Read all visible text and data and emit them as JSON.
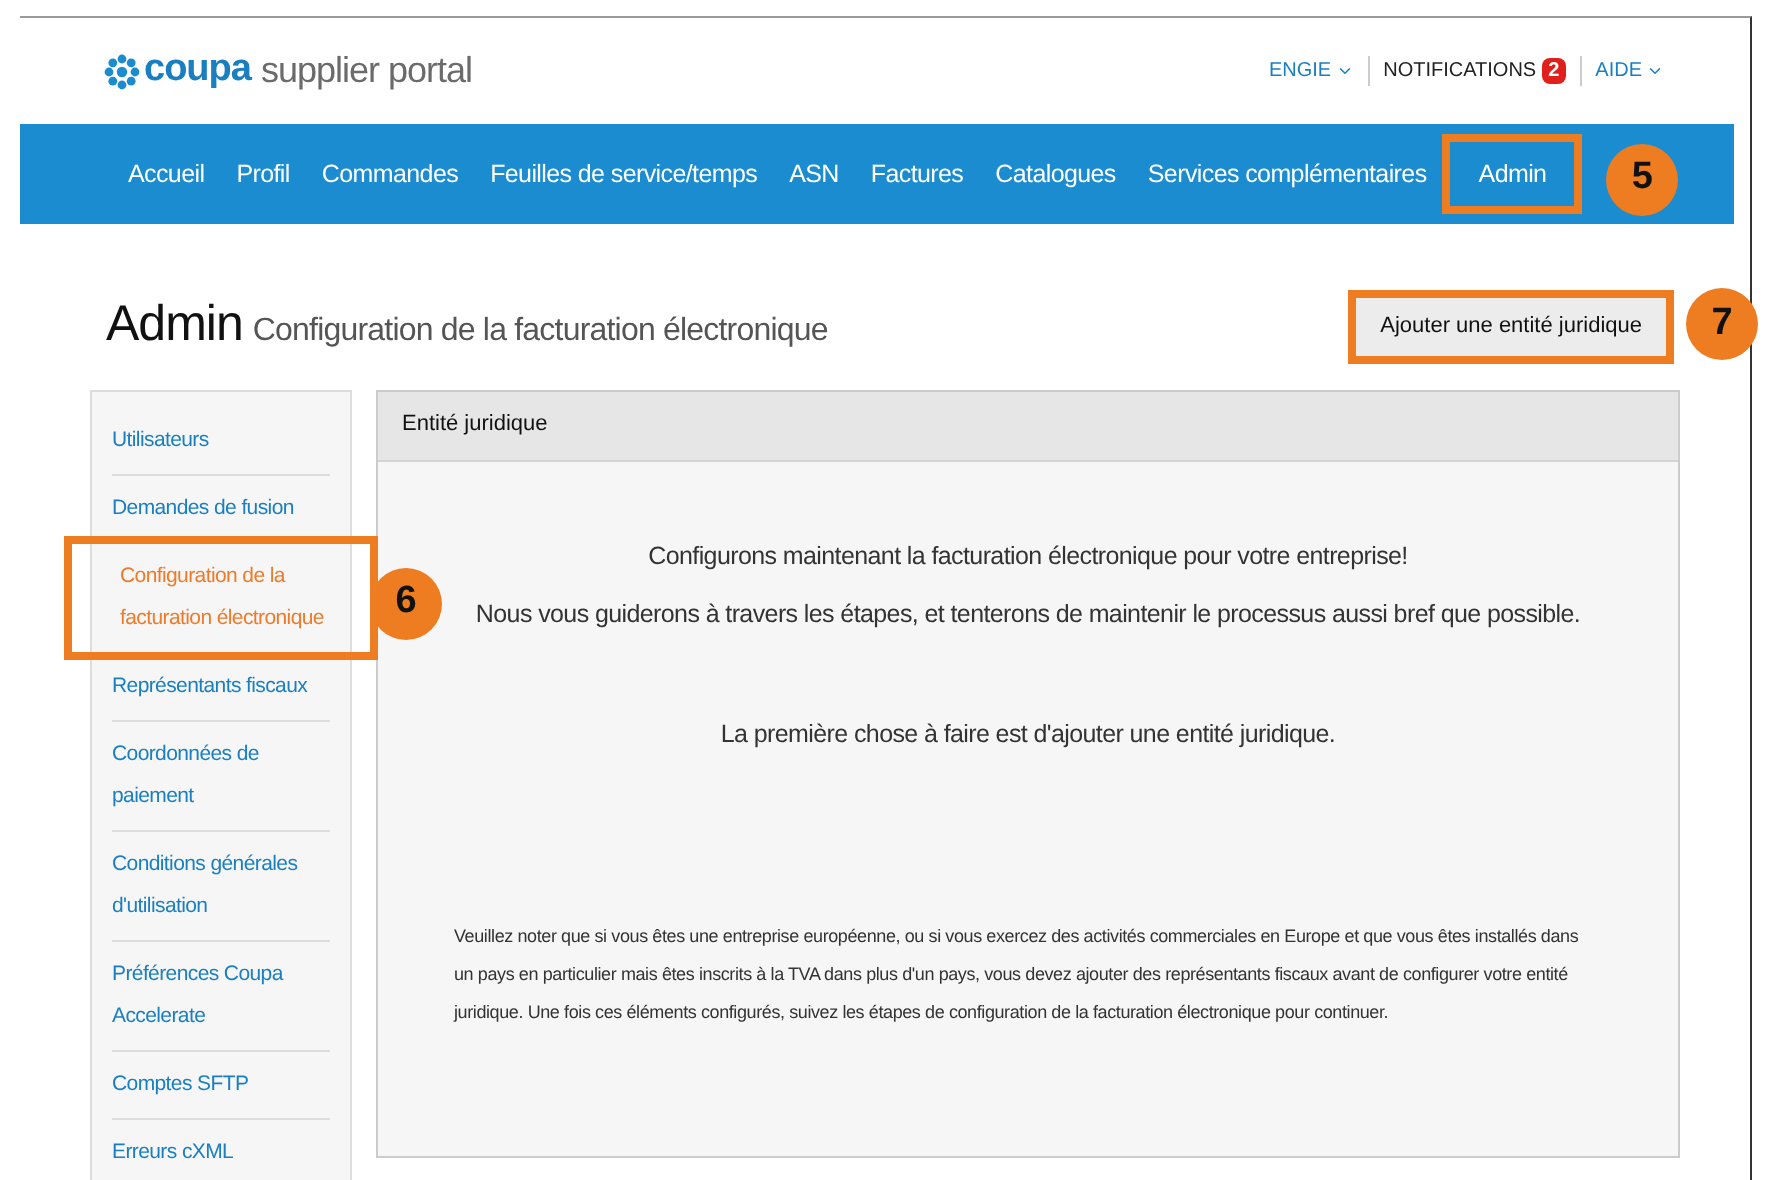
{
  "logo": {
    "brand": "coupa",
    "product": "supplier portal"
  },
  "top_links": [
    {
      "label": "ENGIE",
      "kind": "menu"
    },
    {
      "label": "NOTIFICATIONS",
      "kind": "badge",
      "badge": "2"
    },
    {
      "label": "AIDE",
      "kind": "menu"
    }
  ],
  "nav": [
    {
      "label": "Accueil",
      "highlighted": false
    },
    {
      "label": "Profil",
      "highlighted": false
    },
    {
      "label": "Commandes",
      "highlighted": false
    },
    {
      "label": "Feuilles de service/temps",
      "highlighted": false
    },
    {
      "label": "ASN",
      "highlighted": false
    },
    {
      "label": "Factures",
      "highlighted": false
    },
    {
      "label": "Catalogues",
      "highlighted": false
    },
    {
      "label": "Services complémentaires",
      "highlighted": false
    },
    {
      "label": "Admin",
      "highlighted": true,
      "callout": "5"
    }
  ],
  "page": {
    "title": "Admin",
    "subtitle": "Configuration de la facturation électronique"
  },
  "action_button": {
    "label": "Ajouter une entité juridique",
    "highlighted": true,
    "callout": "7"
  },
  "sidebar": {
    "items": [
      {
        "label": "Utilisateurs",
        "selected": false,
        "highlighted": false
      },
      {
        "label": "Demandes de fusion",
        "selected": false,
        "highlighted": false
      },
      {
        "label": "Configuration de la facturation électronique",
        "selected": true,
        "highlighted": true,
        "callout": "6"
      },
      {
        "label": "Représentants fiscaux",
        "selected": false,
        "highlighted": false
      },
      {
        "label": "Coordonnées de paiement",
        "selected": false,
        "highlighted": false
      },
      {
        "label": "Conditions générales d'utilisation",
        "selected": false,
        "highlighted": false
      },
      {
        "label": "Préférences Coupa Accelerate",
        "selected": false,
        "highlighted": false
      },
      {
        "label": "Comptes SFTP",
        "selected": false,
        "highlighted": false
      },
      {
        "label": "Erreurs cXML",
        "selected": false,
        "highlighted": false
      }
    ]
  },
  "panel": {
    "header": "Entité juridique",
    "intro": [
      "Configurons maintenant la facturation électronique pour votre entreprise!",
      "Nous vous guiderons à travers les étapes, et tenterons de maintenir le processus aussi bref que possible."
    ],
    "first_step": "La première chose à faire est d'ajouter une entité juridique.",
    "note": "Veuillez noter que si vous êtes une entreprise européenne, ou si vous exercez des activités commerciales en Europe et que vous êtes installés dans un pays en particulier mais êtes inscrits à la TVA dans plus d'un pays, vous devez ajouter des représentants fiscaux avant de configurer votre entité juridique. Une fois ces éléments configurés, suivez les étapes de configuration de la facturation électronique pour continuer."
  }
}
